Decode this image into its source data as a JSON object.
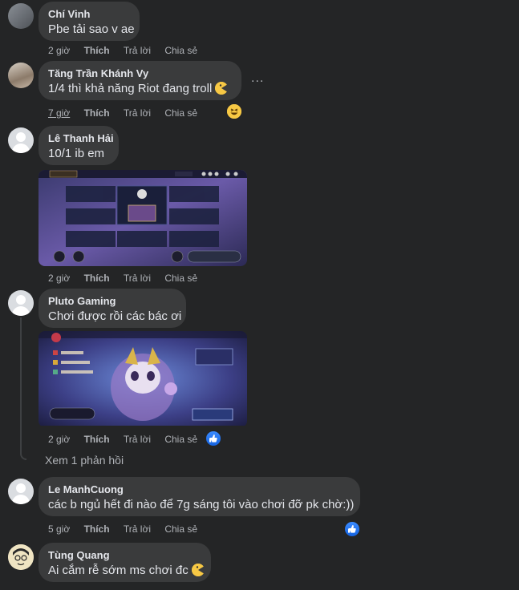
{
  "comments": [
    {
      "author": "Chí Vinh",
      "text": "Pbe tải sao v ae",
      "time": "2 giờ",
      "like": "Thích",
      "reply": "Trả lời",
      "share": "Chia sẻ"
    },
    {
      "author": "Tăng Trần Khánh Vy",
      "text": "1/4 thì khả năng Riot đang troll",
      "emoji": "pacman-emoji",
      "time": "7 giờ",
      "like": "Thích",
      "reply": "Trả lời",
      "share": "Chia sẻ",
      "more": "...",
      "reaction": "haha"
    },
    {
      "author": "Lê Thanh Hải",
      "text": "10/1 ib em",
      "time": "2 giờ",
      "like": "Thích",
      "reply": "Trả lời",
      "share": "Chia sẻ",
      "attachment": "game-lobby-screenshot"
    },
    {
      "author": "Pluto Gaming",
      "text": "Chơi được rồi các bác ơi",
      "time": "2 giờ",
      "like": "Thích",
      "reply": "Trả lời",
      "share": "Chia sẻ",
      "attachment": "game-home-screenshot",
      "reaction": "like",
      "view_replies": "Xem 1 phản hồi"
    },
    {
      "author": "Le ManhCuong",
      "text": "các b ngủ hết đi nào để 7g sáng tôi vào chơi đỡ pk chờ:))",
      "time": "5 giờ",
      "like": "Thích",
      "reply": "Trả lời",
      "share": "Chia sẻ",
      "reaction": "like"
    },
    {
      "author": "Tùng Quang",
      "text": "Ai cắm rễ sớm ms chơi đc",
      "emoji": "pacman-emoji"
    }
  ],
  "colors": {
    "background": "#242526",
    "bubble": "#3a3b3c",
    "text": "#e4e6eb",
    "secondary": "#b0b3b8",
    "like_blue": "#1877f2"
  }
}
